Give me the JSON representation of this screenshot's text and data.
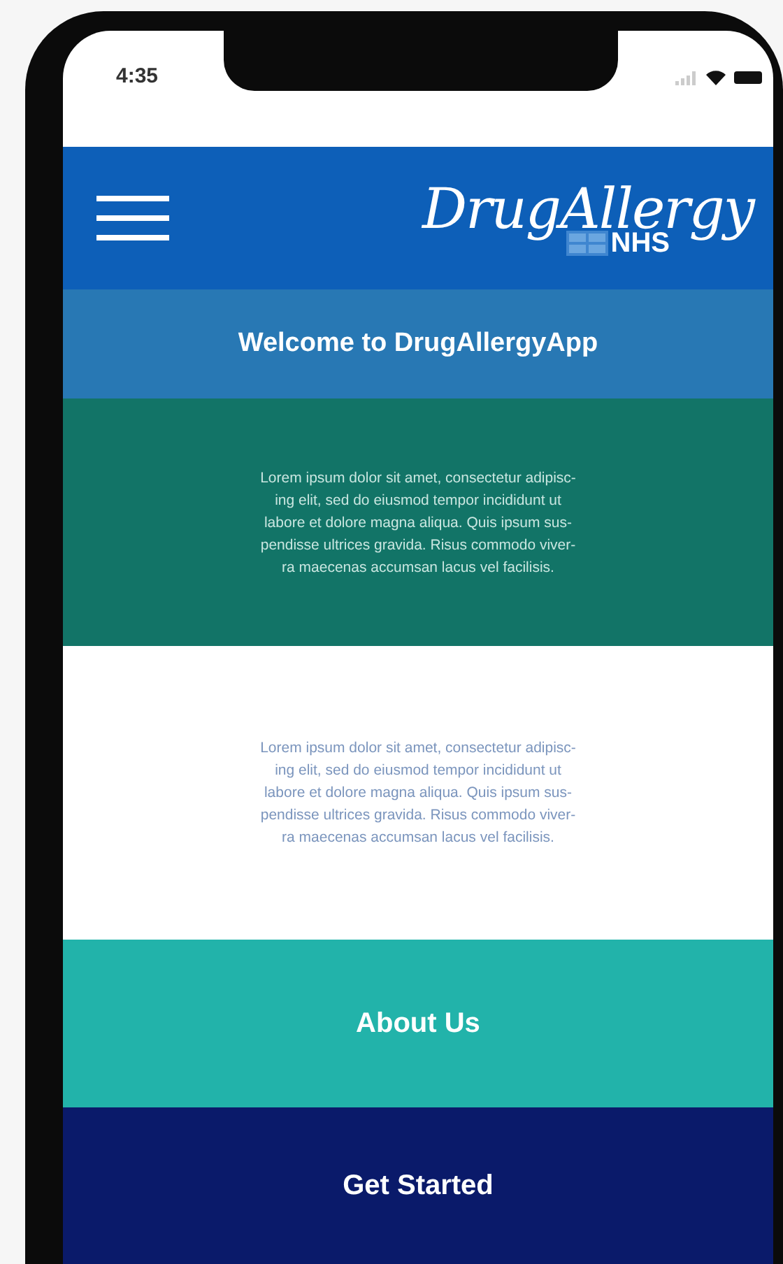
{
  "status_bar": {
    "time": "4:35"
  },
  "header": {
    "logo_title": "DrugAllergy",
    "logo_subtitle": "NHS"
  },
  "welcome": {
    "title": "Welcome to DrugAllergyApp"
  },
  "sections": [
    {
      "kind": "dark",
      "text": "Lorem ipsum dolor sit amet, consectetur adipisc-\ning elit, sed do eiusmod tempor incididunt ut\nlabore et dolore magna aliqua. Quis ipsum sus-\npendisse ultrices gravida. Risus commodo viver-\nra maecenas accumsan lacus vel facilisis."
    },
    {
      "kind": "light",
      "text": "Lorem ipsum dolor sit amet, consectetur adipisc-\ning elit, sed do eiusmod tempor incididunt ut\nlabore et dolore magna aliqua. Quis ipsum sus-\npendisse ultrices gravida. Risus commodo viver-\nra maecenas accumsan lacus vel facilisis."
    }
  ],
  "buttons": [
    {
      "kind": "primary",
      "label": "About Us"
    },
    {
      "kind": "secondary",
      "label": "Get Started"
    }
  ]
}
